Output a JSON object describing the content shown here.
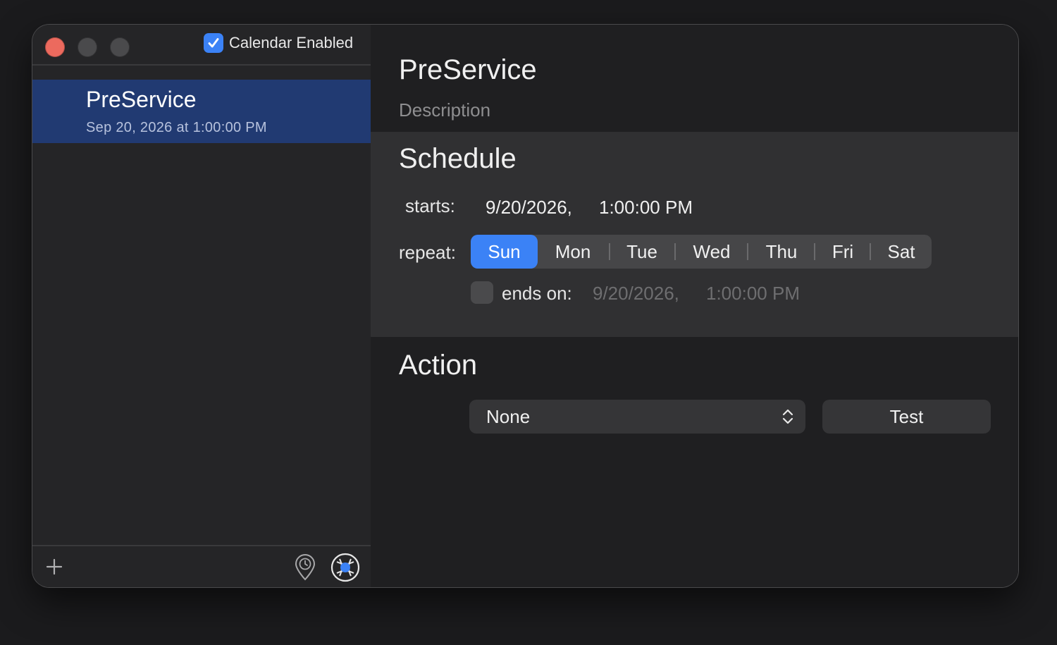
{
  "sidebar": {
    "calendar_enabled_label": "Calendar Enabled",
    "calendar_enabled_checked": true,
    "items": [
      {
        "title": "PreService",
        "subtitle": "Sep 20, 2026 at 1:00:00 PM",
        "selected": true
      }
    ],
    "footer": {
      "add_icon": "plus-icon",
      "location_icon": "location-clock-icon",
      "network_icon": "network-globe-icon"
    }
  },
  "detail": {
    "title": "PreService",
    "description_placeholder": "Description",
    "schedule": {
      "heading": "Schedule",
      "starts_label": "starts:",
      "starts_date": "9/20/2026,",
      "starts_time": "1:00:00 PM",
      "repeat_label": "repeat:",
      "days": [
        "Sun",
        "Mon",
        "Tue",
        "Wed",
        "Thu",
        "Fri",
        "Sat"
      ],
      "selected_day": "Sun",
      "ends_on_label": "ends on:",
      "ends_on_checked": false,
      "ends_date": "9/20/2026,",
      "ends_time": "1:00:00 PM"
    },
    "action": {
      "heading": "Action",
      "selected": "None",
      "test_label": "Test"
    }
  },
  "colors": {
    "accent": "#3b82f6",
    "selection": "#213a72",
    "close": "#ec6a5e"
  }
}
